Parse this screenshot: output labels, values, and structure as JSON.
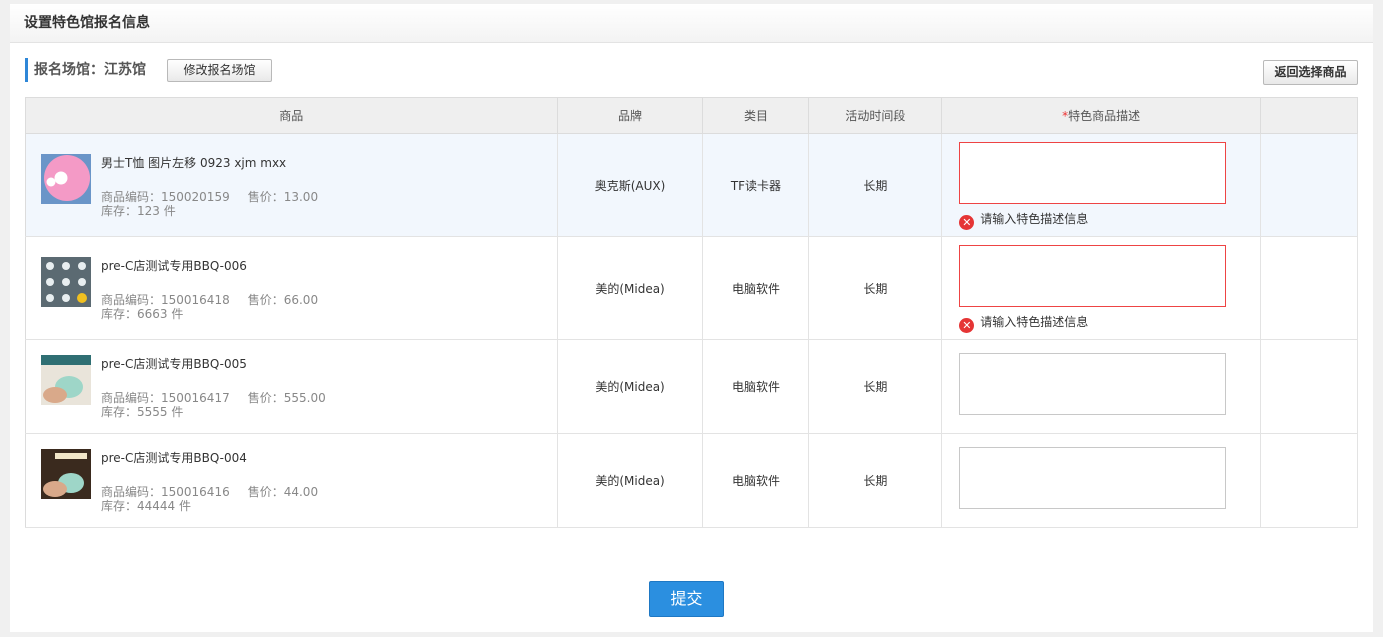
{
  "header": {
    "title": "设置特色馆报名信息"
  },
  "venue": {
    "label": "报名场馆：江苏馆",
    "modify_button": "修改报名场馆",
    "back_button": "返回选择商品"
  },
  "columns": {
    "product": "商品",
    "brand": "品牌",
    "category": "类目",
    "period": "活动时间段",
    "required_mark": "*",
    "description": "特色商品描述"
  },
  "rows": [
    {
      "name": "男士T恤 图片左移 0923 xjm mxx",
      "code": "商品编码：150020159",
      "price": "售价：13.00",
      "stock": "库存：123 件",
      "brand": "奥克斯(AUX)",
      "category": "TF读卡器",
      "period": "长期",
      "error": "请输入特色描述信息"
    },
    {
      "name": "pre-C店测试专用BBQ-006",
      "code": "商品编码：150016418",
      "price": "售价：66.00",
      "stock": "库存：6663 件",
      "brand": "美的(Midea)",
      "category": "电脑软件",
      "period": "长期",
      "error": "请输入特色描述信息"
    },
    {
      "name": "pre-C店测试专用BBQ-005",
      "code": "商品编码：150016417",
      "price": "售价：555.00",
      "stock": "库存：5555 件",
      "brand": "美的(Midea)",
      "category": "电脑软件",
      "period": "长期"
    },
    {
      "name": "pre-C店测试专用BBQ-004",
      "code": "商品编码：150016416",
      "price": "售价：44.00",
      "stock": "库存：44444 件",
      "brand": "美的(Midea)",
      "category": "电脑软件",
      "period": "长期"
    }
  ],
  "submit": {
    "label": "提交"
  },
  "colors": {
    "accent": "#2e87d8",
    "error": "#e53535",
    "submit": "#2b8fe0"
  }
}
